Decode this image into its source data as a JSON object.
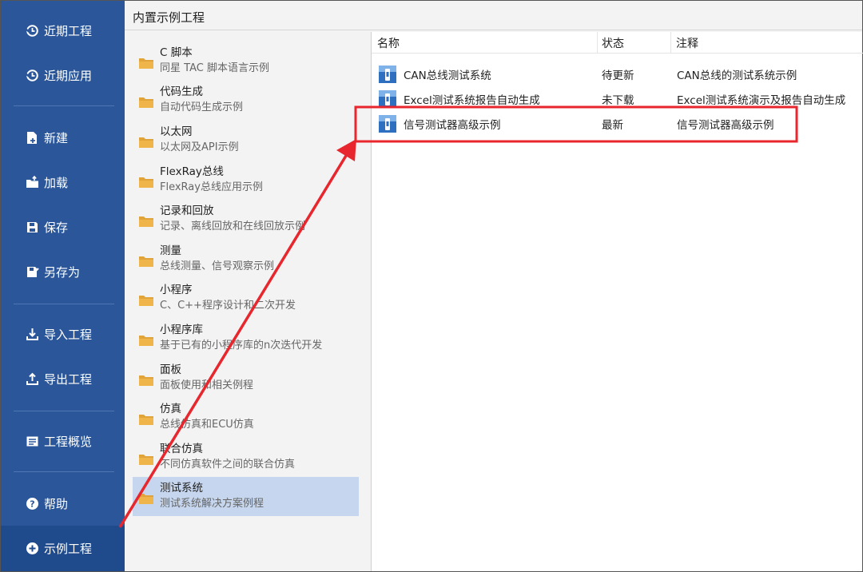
{
  "sidebar": {
    "items": [
      {
        "label": "近期工程",
        "icon": "history-icon"
      },
      {
        "label": "近期应用",
        "icon": "history-icon"
      },
      {
        "label": "新建",
        "icon": "new-file-icon"
      },
      {
        "label": "加载",
        "icon": "folder-open-icon"
      },
      {
        "label": "保存",
        "icon": "save-icon"
      },
      {
        "label": "另存为",
        "icon": "save-as-icon"
      },
      {
        "label": "导入工程",
        "icon": "import-icon"
      },
      {
        "label": "导出工程",
        "icon": "export-icon"
      },
      {
        "label": "工程概览",
        "icon": "overview-icon"
      },
      {
        "label": "帮助",
        "icon": "help-icon"
      },
      {
        "label": "示例工程",
        "icon": "add-circle-icon"
      }
    ],
    "active_index": 10
  },
  "main": {
    "title": "内置示例工程",
    "categories": [
      {
        "title": "C 脚本",
        "subtitle": "同星 TAC 脚本语言示例"
      },
      {
        "title": "代码生成",
        "subtitle": "自动代码生成示例"
      },
      {
        "title": "以太网",
        "subtitle": "以太网及API示例"
      },
      {
        "title": "FlexRay总线",
        "subtitle": "FlexRay总线应用示例"
      },
      {
        "title": "记录和回放",
        "subtitle": "记录、离线回放和在线回放示例"
      },
      {
        "title": "测量",
        "subtitle": "总线测量、信号观察示例"
      },
      {
        "title": "小程序",
        "subtitle": "C、C++程序设计和二次开发"
      },
      {
        "title": "小程序库",
        "subtitle": "基于已有的小程序库的n次迭代开发"
      },
      {
        "title": "面板",
        "subtitle": "面板使用和相关例程"
      },
      {
        "title": "仿真",
        "subtitle": "总线仿真和ECU仿真"
      },
      {
        "title": "联合仿真",
        "subtitle": "不同仿真软件之间的联合仿真"
      },
      {
        "title": "测试系统",
        "subtitle": "测试系统解决方案例程"
      }
    ],
    "selected_category": 11
  },
  "table": {
    "columns": [
      "名称",
      "状态",
      "注释"
    ],
    "rows": [
      {
        "name": "CAN总线测试系统",
        "status": "待更新",
        "note": "CAN总线的测试系统示例"
      },
      {
        "name": "Excel测试系统报告自动生成",
        "status": "未下载",
        "note": "Excel测试系统演示及报告自动生成"
      },
      {
        "name": "信号测试器高级示例",
        "status": "最新",
        "note": "信号测试器高级示例"
      }
    ],
    "highlighted_row": 2
  },
  "colors": {
    "sidebar_bg": "#2b579a",
    "sidebar_active": "#1f4a8c",
    "selection_bg": "#c5d6ee",
    "annotation_red": "#e8262d",
    "folder": "#f0b54a"
  }
}
